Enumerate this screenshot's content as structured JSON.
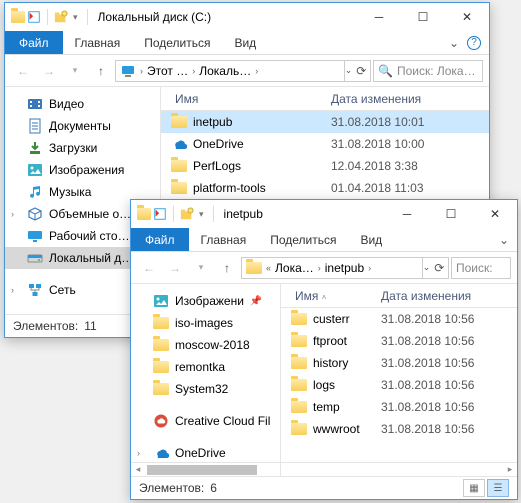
{
  "win1": {
    "title": "Локальный диск (C:)",
    "ribbon": {
      "file": "Файл",
      "tabs": [
        "Главная",
        "Поделиться",
        "Вид"
      ]
    },
    "address": {
      "root": "Этот …",
      "parts": [
        "Локаль…"
      ]
    },
    "search_placeholder": "Поиск: Лока…",
    "nav": [
      {
        "label": "Видео",
        "icon": "video"
      },
      {
        "label": "Документы",
        "icon": "doc"
      },
      {
        "label": "Загрузки",
        "icon": "download"
      },
      {
        "label": "Изображения",
        "icon": "image"
      },
      {
        "label": "Музыка",
        "icon": "music"
      },
      {
        "label": "Объемные о…",
        "icon": "3d",
        "expandable": true
      },
      {
        "label": "Рабочий сто…",
        "icon": "desktop"
      },
      {
        "label": "Локальный д…",
        "icon": "disk",
        "selected": true
      },
      {
        "label": "Сеть",
        "icon": "network",
        "gap": true,
        "expandable": true
      }
    ],
    "columns": {
      "name": "Имя",
      "date": "Дата изменения",
      "name_w": 170
    },
    "rows": [
      {
        "name": "inetpub",
        "icon": "folder",
        "date": "31.08.2018 10:01",
        "selected": true
      },
      {
        "name": "OneDrive",
        "icon": "onedrive",
        "date": "31.08.2018 10:00"
      },
      {
        "name": "PerfLogs",
        "icon": "folder",
        "date": "12.04.2018 3:38"
      },
      {
        "name": "platform-tools",
        "icon": "folder",
        "date": "01.04.2018 11:03"
      }
    ],
    "status": {
      "label": "Элементов:",
      "count": "11"
    }
  },
  "win2": {
    "title": "inetpub",
    "ribbon": {
      "file": "Файл",
      "tabs": [
        "Главная",
        "Поделиться",
        "Вид"
      ]
    },
    "address": {
      "parts": [
        "Лока…",
        "inetpub"
      ]
    },
    "search_placeholder": "Поиск:",
    "nav": [
      {
        "label": "Изображени",
        "icon": "image",
        "pinned": true
      },
      {
        "label": "iso-images",
        "icon": "folder"
      },
      {
        "label": "moscow-2018",
        "icon": "folder"
      },
      {
        "label": "remontka",
        "icon": "folder"
      },
      {
        "label": "System32",
        "icon": "folder"
      },
      {
        "label": "Creative Cloud Fil",
        "icon": "ccloud",
        "gap": true
      },
      {
        "label": "OneDrive",
        "icon": "onedrive",
        "gap": true,
        "expandable": true
      }
    ],
    "columns": {
      "name": "Имя",
      "date": "Дата изменения",
      "name_w": 100
    },
    "rows": [
      {
        "name": "custerr",
        "icon": "folder",
        "date": "31.08.2018 10:56"
      },
      {
        "name": "ftproot",
        "icon": "folder",
        "date": "31.08.2018 10:56"
      },
      {
        "name": "history",
        "icon": "folder",
        "date": "31.08.2018 10:56"
      },
      {
        "name": "logs",
        "icon": "folder",
        "date": "31.08.2018 10:56"
      },
      {
        "name": "temp",
        "icon": "folder",
        "date": "31.08.2018 10:56"
      },
      {
        "name": "wwwroot",
        "icon": "folder",
        "date": "31.08.2018 10:56"
      }
    ],
    "status": {
      "label": "Элементов:",
      "count": "6"
    }
  }
}
